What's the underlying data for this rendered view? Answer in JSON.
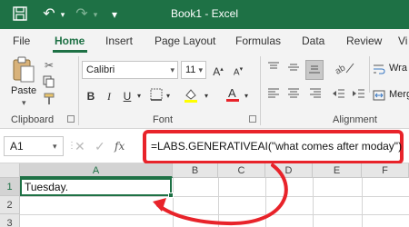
{
  "titlebar": {
    "title": "Book1  -  Excel",
    "icons": [
      "save-icon",
      "undo-icon",
      "redo-icon",
      "customize-icon"
    ]
  },
  "tabs": [
    {
      "label": "File"
    },
    {
      "label": "Home"
    },
    {
      "label": "Insert"
    },
    {
      "label": "Page Layout"
    },
    {
      "label": "Formulas"
    },
    {
      "label": "Data"
    },
    {
      "label": "Review"
    },
    {
      "label": "Vi"
    }
  ],
  "ribbon": {
    "clipboard": {
      "label": "Clipboard",
      "paste_label": "Paste"
    },
    "font": {
      "label": "Font",
      "family": "Calibri",
      "size": "11"
    },
    "alignment": {
      "label": "Alignment",
      "wrap_label": "Wra",
      "merge_label": "Merg"
    }
  },
  "formula_bar": {
    "name_box": "A1",
    "fx": "fx",
    "formula": "=LABS.GENERATIVEAI(\"what comes after moday\")"
  },
  "grid": {
    "columns": [
      "A",
      "B",
      "C",
      "D",
      "E",
      "F"
    ],
    "rows": [
      "1",
      "2",
      "3"
    ],
    "cells": {
      "A1": "Tuesday."
    }
  },
  "colors": {
    "excel_green": "#1e7145",
    "annotation_red": "#e8232a",
    "font_color_red": "#e8232a",
    "highlight_yellow": "#ffff00"
  }
}
